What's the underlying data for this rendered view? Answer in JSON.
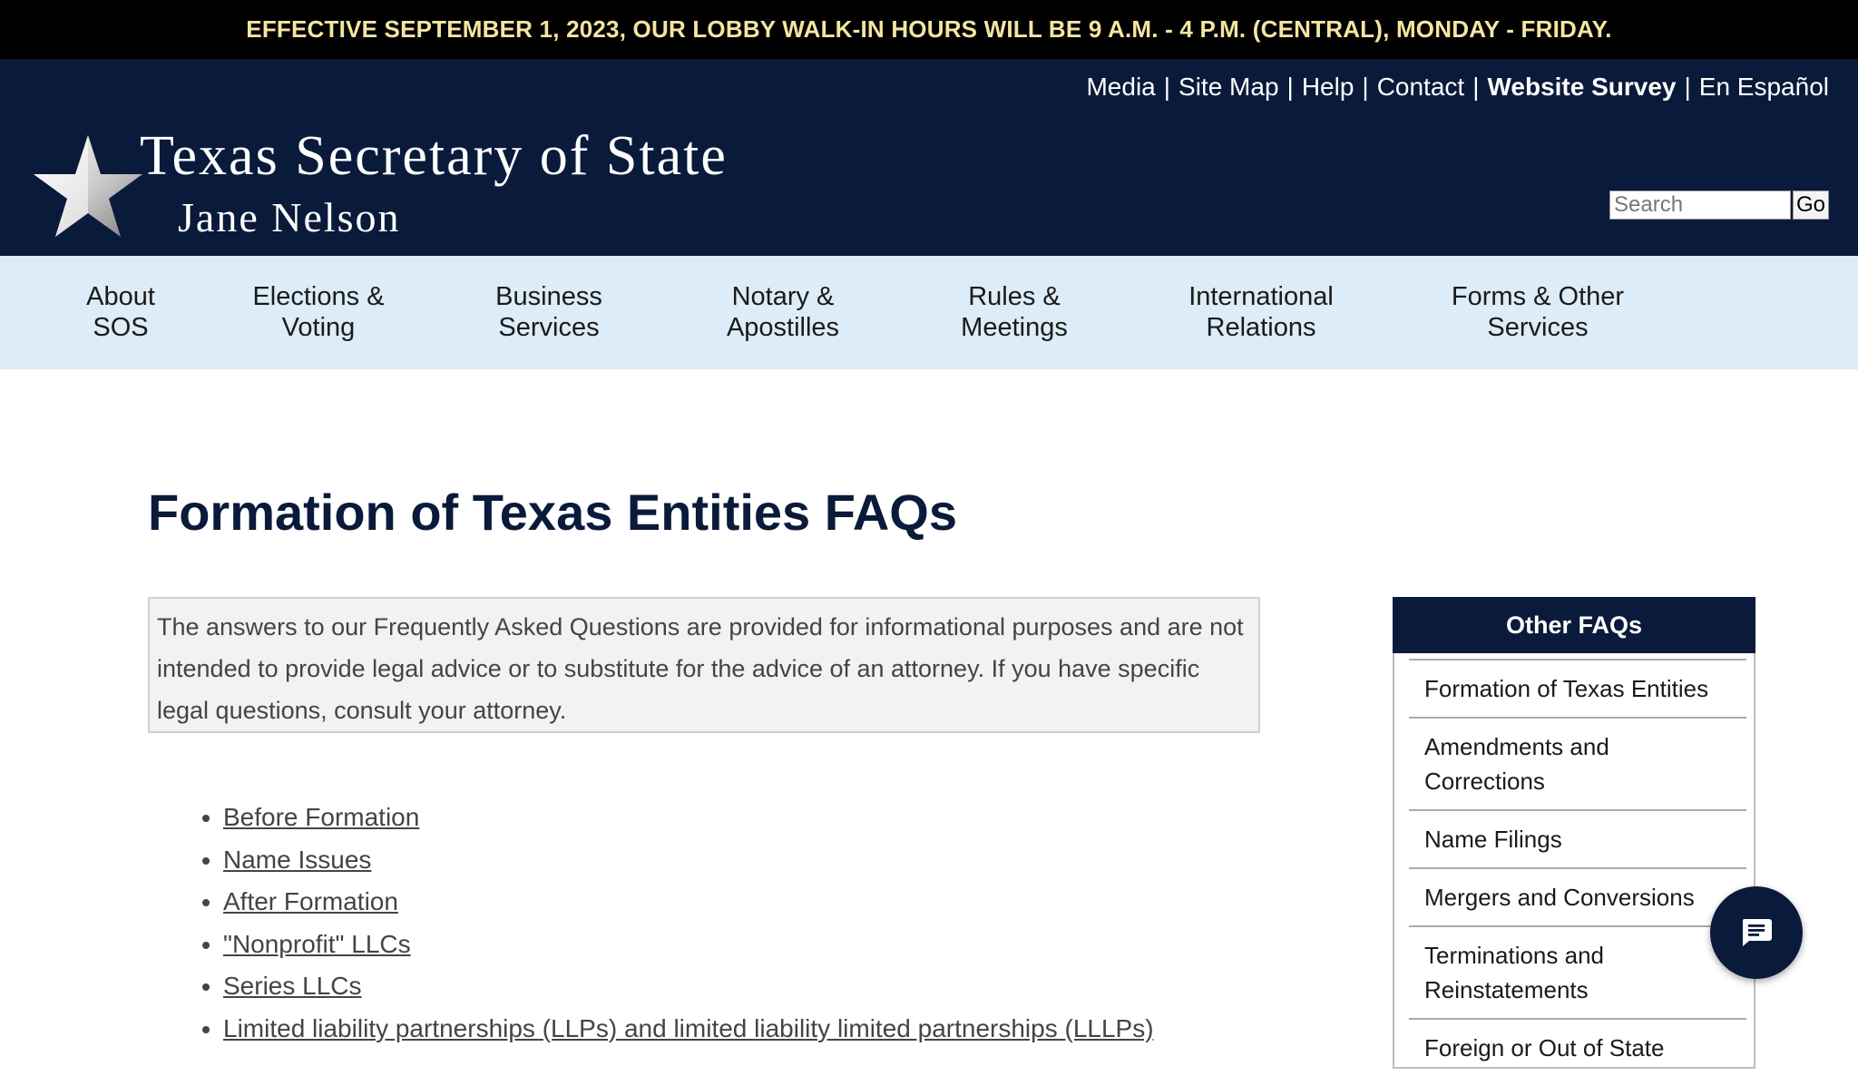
{
  "alert": {
    "text": "EFFECTIVE SEPTEMBER 1, 2023, OUR LOBBY WALK-IN HOURS WILL BE 9 A.M. - 4 P.M. (CENTRAL), MONDAY - FRIDAY."
  },
  "utility_nav": {
    "media": "Media",
    "site_map": "Site Map",
    "help": "Help",
    "contact": "Contact",
    "survey": "Website Survey",
    "espanol": "En Español",
    "separator": "|"
  },
  "logo": {
    "title": "Texas Secretary of State",
    "subtitle": "Jane Nelson",
    "icon": "star-icon"
  },
  "search": {
    "placeholder": "Search",
    "button_label": "Go"
  },
  "main_nav": {
    "items": [
      {
        "label": "About\nSOS"
      },
      {
        "label": "Elections &\nVoting"
      },
      {
        "label": "Business\nServices"
      },
      {
        "label": "Notary &\nApostilles"
      },
      {
        "label": "Rules &\nMeetings"
      },
      {
        "label": "International\nRelations"
      },
      {
        "label": "Forms & Other\nServices"
      }
    ]
  },
  "page": {
    "title": "Formation of Texas Entities FAQs",
    "disclaimer": "The answers to our Frequently Asked Questions are provided for informational purposes and are not intended to provide legal advice or to substitute for the advice of an attorney. If you have specific legal questions, consult your attorney.",
    "faq_links": [
      "Before Formation",
      "Name Issues",
      "After Formation",
      "\"Nonprofit\" LLCs",
      "Series LLCs",
      "Limited liability partnerships (LLPs) and limited liability limited partnerships (LLLPs)"
    ]
  },
  "sidebar": {
    "header": "Other FAQs",
    "items": [
      "Formation of Texas Entities",
      "Amendments and Corrections",
      "Name Filings",
      "Mergers and Conversions",
      "Terminations and Reinstatements",
      "Foreign or Out of State"
    ]
  },
  "chat": {
    "icon": "chat-icon"
  },
  "colors": {
    "navy": "#0a1a3a",
    "alert_text": "#f3e6a0",
    "nav_bg": "#dcecf8"
  }
}
